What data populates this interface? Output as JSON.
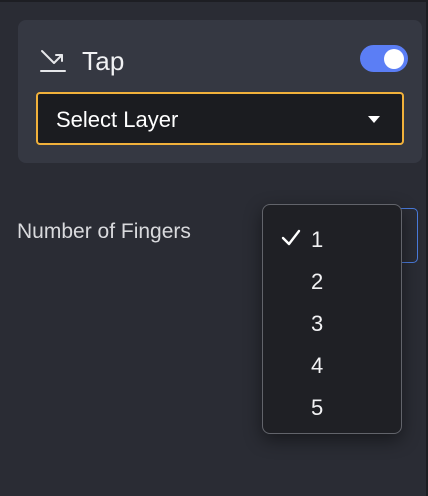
{
  "card": {
    "title": "Tap",
    "icon": "tap-gesture-icon",
    "toggle_on": true,
    "toggle_color": "#5b7ef5",
    "select_layer": {
      "value": "Select Layer",
      "border_color": "#f1b13b"
    }
  },
  "fingers": {
    "label": "Number of Fingers",
    "selected": "1",
    "options": [
      "1",
      "2",
      "3",
      "4",
      "5"
    ]
  }
}
